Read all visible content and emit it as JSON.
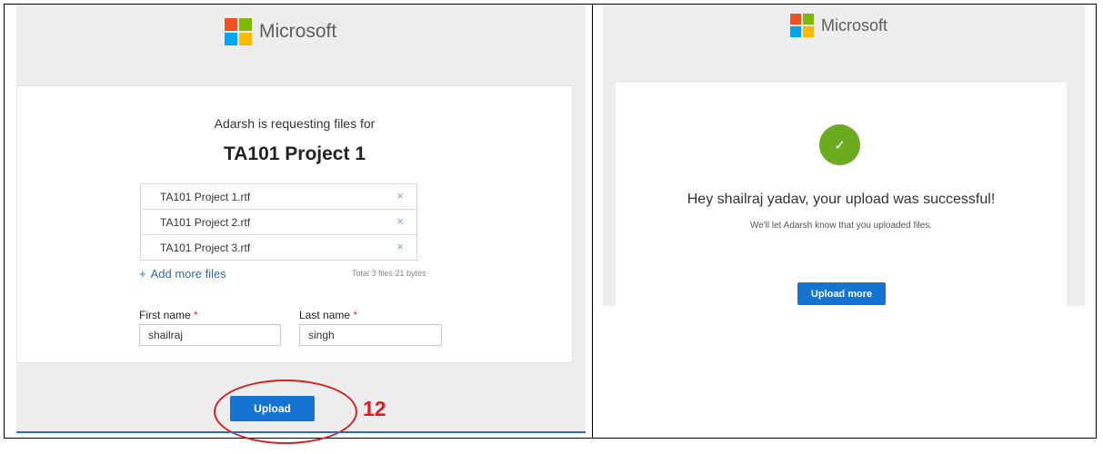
{
  "left": {
    "brand": "Microsoft",
    "requesting_text": "Adarsh is requesting files for",
    "project_title": "TA101 Project 1",
    "files": [
      "TA101 Project 1.rtf",
      "TA101 Project 2.rtf",
      "TA101 Project 3.rtf"
    ],
    "remove_glyph": "×",
    "add_more_label": "Add more files",
    "total_text": "Total 3 files  21 bytes",
    "first_name_label": "First name",
    "first_name_value": "shailraj",
    "last_name_label": "Last name",
    "last_name_value": "singh",
    "required_marker": "*",
    "upload_label": "Upload",
    "annotation_number": "12"
  },
  "right": {
    "brand": "Microsoft",
    "success_title": "Hey shailraj yadav, your upload was successful!",
    "success_sub": "We'll let Adarsh know that you uploaded files.",
    "upload_more_label": "Upload more"
  },
  "icons": {
    "check": "check-icon",
    "close": "close-icon",
    "plus": "plus-icon",
    "logo": "microsoft-logo-icon"
  },
  "colors": {
    "ms_red": "#f25022",
    "ms_green": "#7fba00",
    "ms_blue": "#00a4ef",
    "ms_yellow": "#ffb900",
    "primary_button": "#1573d1",
    "success_green": "#6aab1f",
    "annotation_red": "#d42020"
  }
}
